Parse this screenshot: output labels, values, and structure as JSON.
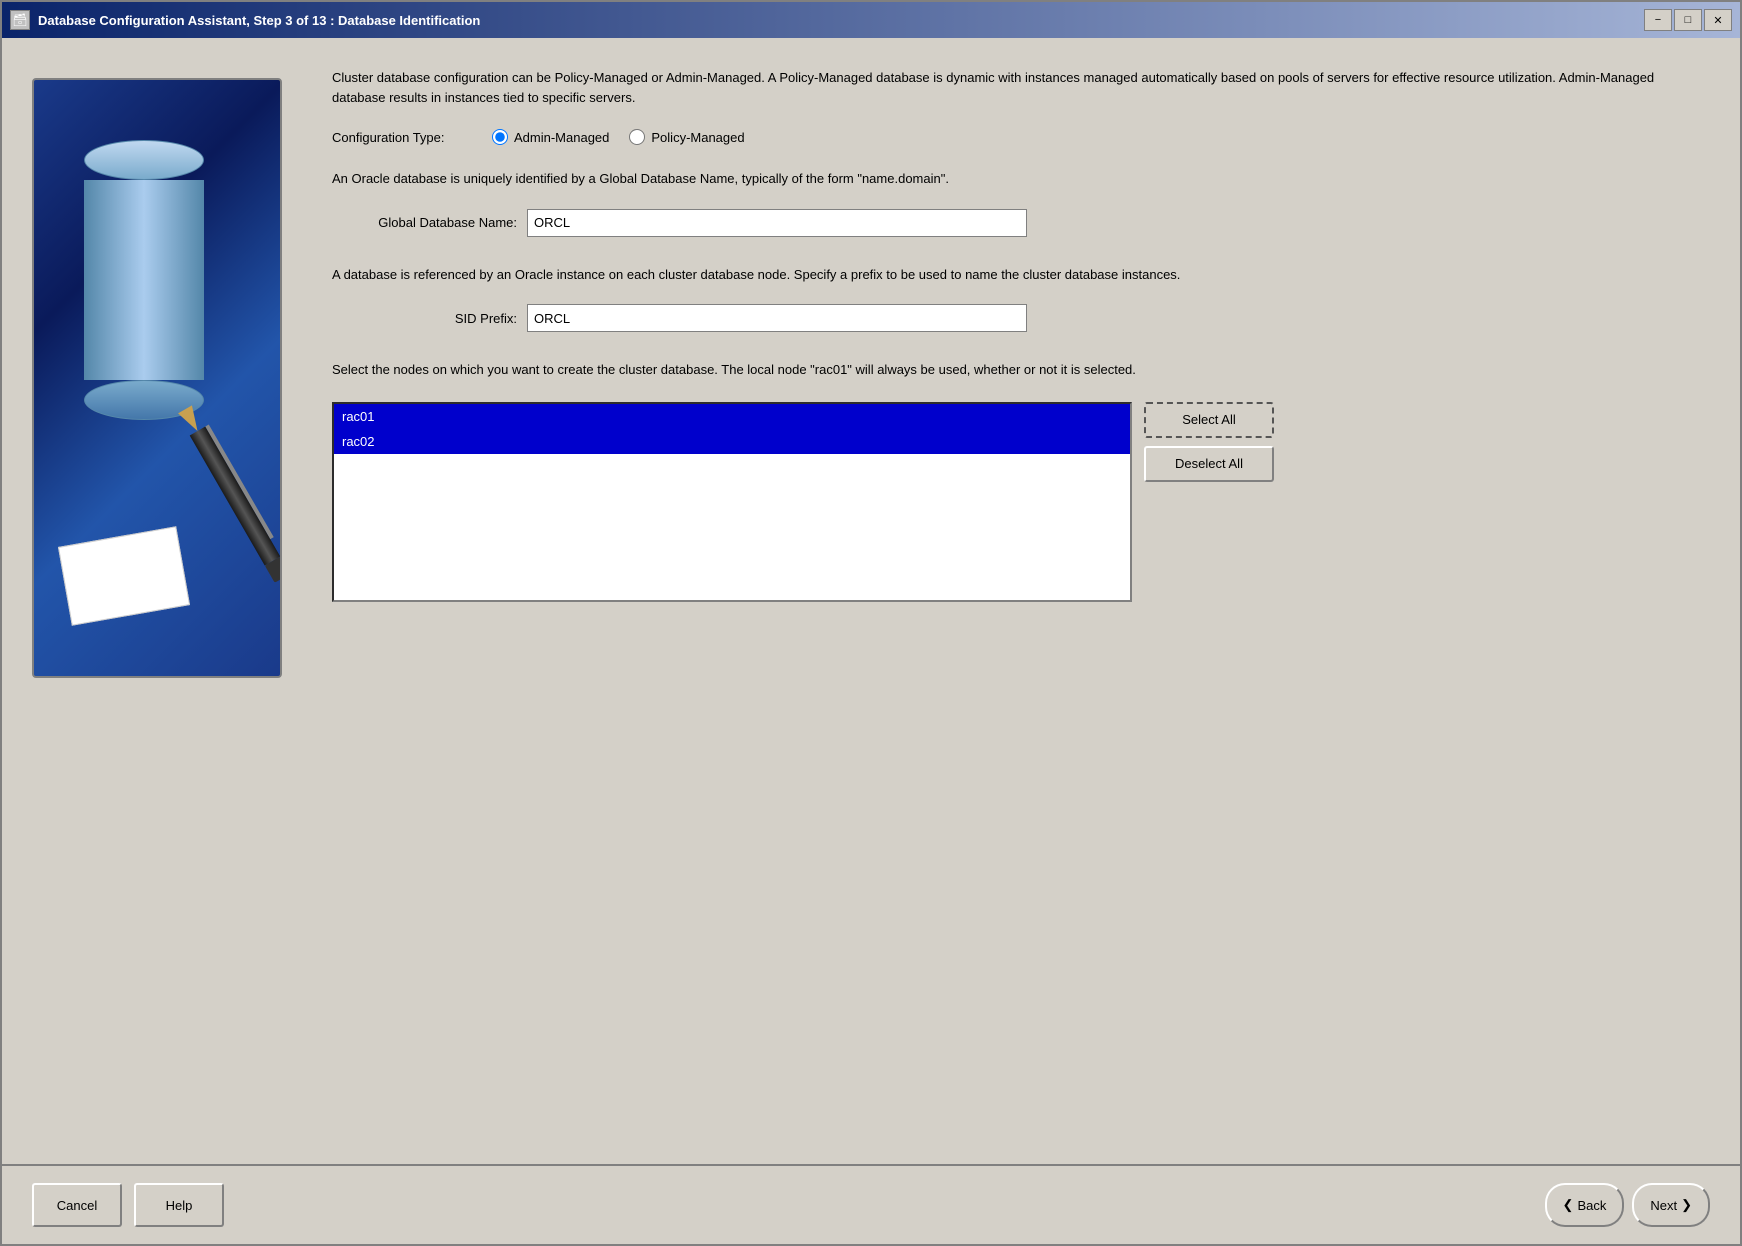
{
  "window": {
    "title": "Database Configuration Assistant, Step 3 of 13 : Database Identification",
    "icon": "🗃"
  },
  "titlebar": {
    "minimize": "−",
    "maximize": "□",
    "close": "✕"
  },
  "content": {
    "intro_text": "Cluster database configuration can be Policy-Managed or Admin-Managed. A Policy-Managed database is dynamic with instances managed automatically based on pools of servers for effective resource utilization. Admin-Managed database results in instances tied to specific servers.",
    "config_type_label": "Configuration Type:",
    "radio_admin": "Admin-Managed",
    "radio_policy": "Policy-Managed",
    "admin_selected": true,
    "sub_description": "An Oracle database is uniquely identified by a Global Database Name, typically of the form \"name.domain\".",
    "global_db_label": "Global Database Name:",
    "global_db_value": "ORCL",
    "instance_description": "A database is referenced by an Oracle instance on each cluster database node. Specify a prefix to be used to name the cluster database instances.",
    "sid_prefix_label": "SID Prefix:",
    "sid_prefix_value": "ORCL",
    "nodes_description": "Select the nodes on which you want to create the cluster database. The local node \"rac01\" will always be used, whether or not it is selected.",
    "nodes": [
      {
        "label": "rac01",
        "selected": true
      },
      {
        "label": "rac02",
        "selected": true
      }
    ],
    "select_all_btn": "Select All",
    "deselect_all_btn": "Deselect All",
    "cancel_btn": "Cancel",
    "help_btn": "Help",
    "back_btn": "Back",
    "next_btn": "Next",
    "back_chevron": "❮",
    "next_chevron": "❯"
  }
}
